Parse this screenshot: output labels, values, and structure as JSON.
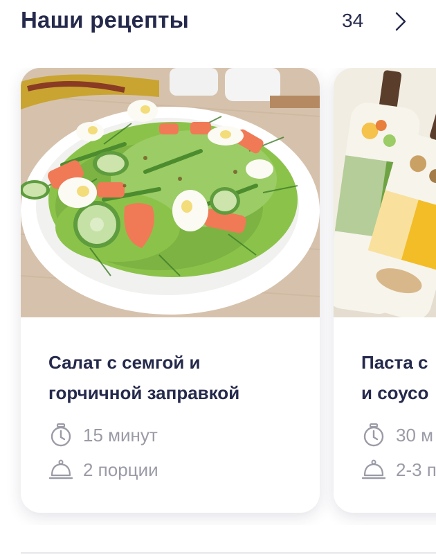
{
  "section": {
    "title": "Наши рецепты",
    "count": "34",
    "arrow_icon": "chevron-right-icon"
  },
  "recipes": [
    {
      "title_line1": "Салат с семгой и",
      "title_line2": "горчичной заправкой",
      "time": "15 минут",
      "portions": "2 порции",
      "image": "salmon-salad-photo"
    },
    {
      "title_line1": "Паста с",
      "title_line2": "и соусо",
      "time": "30 м",
      "portions": "2-3 п",
      "image": "biolio-oil-bottles-photo"
    }
  ],
  "icons": {
    "time": "stopwatch-icon",
    "portions": "cloche-icon"
  },
  "colors": {
    "title": "#252a4c",
    "muted": "#9a9ba6",
    "background": "#ffffff"
  }
}
